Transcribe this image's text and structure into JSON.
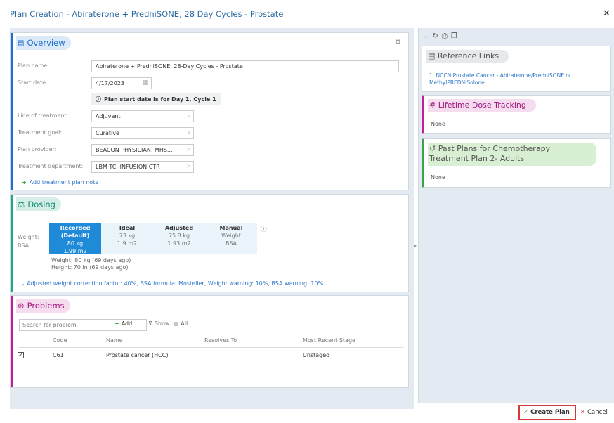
{
  "window": {
    "title": "Plan Creation - Abiraterone + PredniSONE, 28 Day Cycles - Prostate"
  },
  "colors": {
    "accent": "#2f77c9",
    "overview": "#1f6fd1",
    "dosing": "#20a68a",
    "problems": "#c2209b",
    "lifetime": "#c2209b",
    "past": "#3aa34a",
    "create_outline": "#d23a3a"
  },
  "overview": {
    "header": "Overview",
    "plan_name_label": "Plan name:",
    "plan_name": "Abiraterone + PredniSONE, 28-Day Cycles - Prostate",
    "start_date_label": "Start date:",
    "start_date": "4/17/2023",
    "start_note": "Plan start date is for Day 1, Cycle 1",
    "line_label": "Line of treatment:",
    "line": "Adjuvant",
    "goal_label": "Treatment goal:",
    "goal": "Curative",
    "provider_label": "Plan provider:",
    "provider": "BEACON PHYSICIAN, MHS...",
    "dept_label": "Treatment department:",
    "dept": "LBM TCI-INFUSION CTR",
    "add_note": "Add treatment plan note"
  },
  "dosing": {
    "header": "Dosing",
    "row_weight": "Weight:",
    "row_bsa": "BSA:",
    "columns": [
      {
        "name": "Recorded (Default)",
        "weight": "80 kg",
        "bsa": "1.99 m2"
      },
      {
        "name": "Ideal",
        "weight": "73 kg",
        "bsa": "1.9 m2"
      },
      {
        "name": "Adjusted",
        "weight": "75.8 kg",
        "bsa": "1.93 m2"
      },
      {
        "name": "Manual",
        "weight": "Weight",
        "bsa": "BSA"
      }
    ],
    "weight_line": "Weight:  80 kg (69 days ago)",
    "height_line": "Height:  70 in (69 days ago)",
    "correction": "Adjusted weight correction factor: 40%, BSA formula: Mosteller, Weight warning: 10%, BSA warning: 10%"
  },
  "problems": {
    "header": "Problems",
    "search_placeholder": "Search for problem",
    "add": "Add",
    "show": "Show:",
    "all": "All",
    "columns": [
      "Code",
      "Name",
      "Resolves To",
      "Most Recent Stage"
    ],
    "rows": [
      {
        "code": "C61",
        "name": "Prostate cancer (HCC)",
        "resolves": "",
        "stage": "Unstaged"
      }
    ]
  },
  "sidebar": {
    "reference": {
      "header": "Reference Links",
      "link": "1. NCCN Prostate Cancer - Abiraterone/PredniSONE or MethylPREDNISolone"
    },
    "lifetime": {
      "header": "Lifetime Dose Tracking",
      "value": "None"
    },
    "past": {
      "header": "Past Plans for Chemotherapy Treatment Plan 2- Adults",
      "value": "None"
    }
  },
  "footer": {
    "create": "Create Plan",
    "cancel": "Cancel"
  }
}
